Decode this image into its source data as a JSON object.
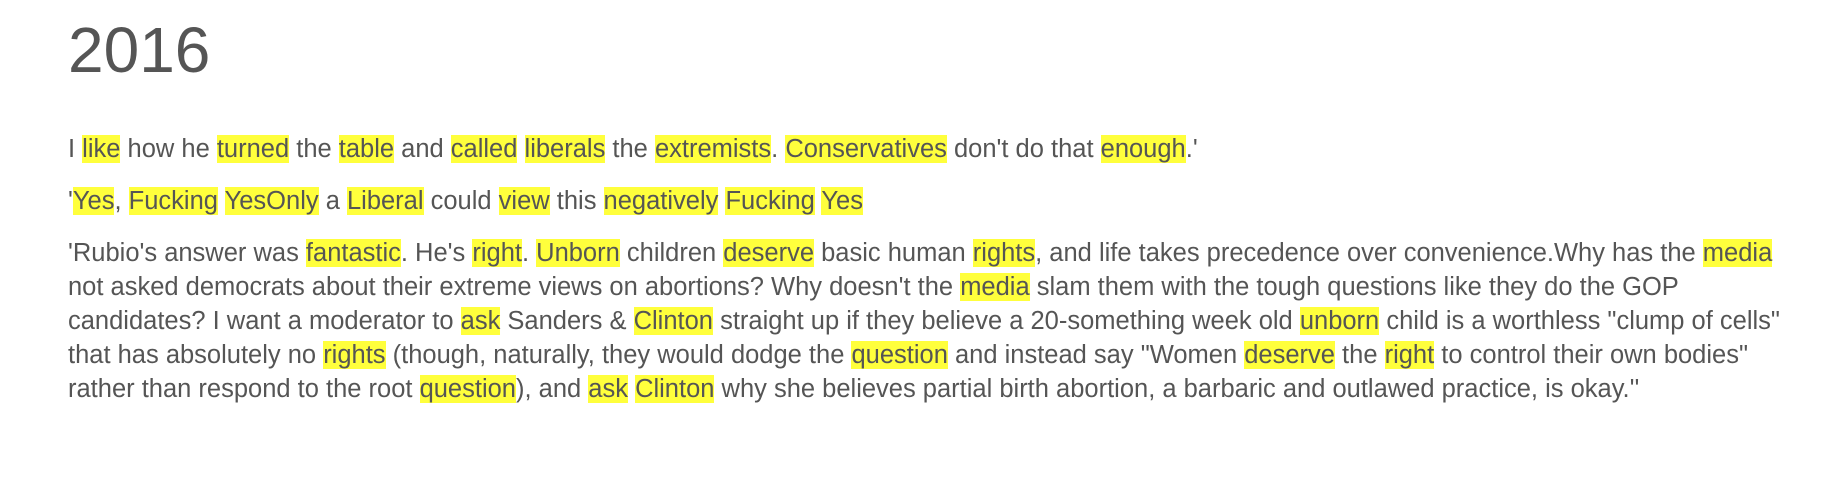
{
  "heading": "2016",
  "highlight_color": "#ffff3c",
  "paragraphs": [
    [
      {
        "t": "I "
      },
      {
        "t": "like",
        "h": true
      },
      {
        "t": " how he "
      },
      {
        "t": "turned",
        "h": true
      },
      {
        "t": " the "
      },
      {
        "t": "table",
        "h": true
      },
      {
        "t": " and "
      },
      {
        "t": "called",
        "h": true
      },
      {
        "t": " "
      },
      {
        "t": "liberals",
        "h": true
      },
      {
        "t": " the "
      },
      {
        "t": "extremists",
        "h": true
      },
      {
        "t": ". "
      },
      {
        "t": "Conservatives",
        "h": true
      },
      {
        "t": " don't do that "
      },
      {
        "t": "enough",
        "h": true
      },
      {
        "t": ".'"
      }
    ],
    [
      {
        "t": "'"
      },
      {
        "t": "Yes",
        "h": true
      },
      {
        "t": ", "
      },
      {
        "t": "Fucking",
        "h": true
      },
      {
        "t": " "
      },
      {
        "t": "YesOnly",
        "h": true
      },
      {
        "t": " a "
      },
      {
        "t": "Liberal",
        "h": true
      },
      {
        "t": " could "
      },
      {
        "t": "view",
        "h": true
      },
      {
        "t": " this "
      },
      {
        "t": "negatively",
        "h": true
      },
      {
        "t": " "
      },
      {
        "t": "Fucking",
        "h": true
      },
      {
        "t": " "
      },
      {
        "t": "Yes",
        "h": true
      }
    ],
    [
      {
        "t": "'Rubio's answer was "
      },
      {
        "t": "fantastic",
        "h": true
      },
      {
        "t": ". He's "
      },
      {
        "t": "right",
        "h": true
      },
      {
        "t": ". "
      },
      {
        "t": "Unborn",
        "h": true
      },
      {
        "t": " children "
      },
      {
        "t": "deserve",
        "h": true
      },
      {
        "t": " basic human "
      },
      {
        "t": "rights",
        "h": true
      },
      {
        "t": ", and life takes precedence over convenience.Why has the "
      },
      {
        "t": "media",
        "h": true
      },
      {
        "t": " not asked democrats about their extreme views on abortions? Why doesn't the "
      },
      {
        "t": "media",
        "h": true
      },
      {
        "t": " slam them with the tough questions like they do the GOP candidates? I want a moderator to "
      },
      {
        "t": "ask",
        "h": true
      },
      {
        "t": " Sanders & "
      },
      {
        "t": "Clinton",
        "h": true
      },
      {
        "t": " straight up if they believe a 20-something week old "
      },
      {
        "t": "unborn",
        "h": true
      },
      {
        "t": " child is a worthless \"clump of cells\" that has absolutely no "
      },
      {
        "t": "rights",
        "h": true
      },
      {
        "t": " (though, naturally, they would dodge the "
      },
      {
        "t": "question",
        "h": true
      },
      {
        "t": " and instead say \"Women "
      },
      {
        "t": "deserve",
        "h": true
      },
      {
        "t": " the "
      },
      {
        "t": "right",
        "h": true
      },
      {
        "t": " to control their own bodies\" rather than respond to the root "
      },
      {
        "t": "question",
        "h": true
      },
      {
        "t": "), and "
      },
      {
        "t": "ask",
        "h": true
      },
      {
        "t": " "
      },
      {
        "t": "Clinton",
        "h": true
      },
      {
        "t": " why she believes partial birth abortion, a barbaric and outlawed practice, is okay.''"
      }
    ]
  ]
}
